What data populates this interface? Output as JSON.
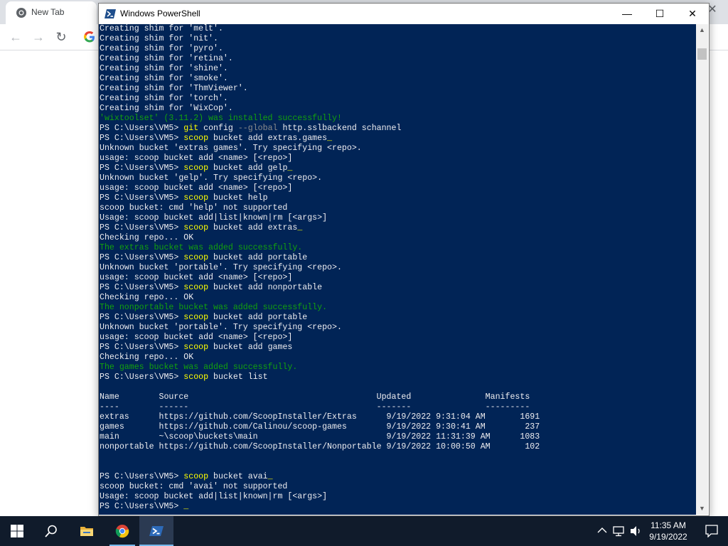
{
  "chrome": {
    "tab_title": "New Tab"
  },
  "powershell": {
    "title": "Windows PowerShell",
    "lines": [
      [
        {
          "t": "Creating shim for 'melt'."
        }
      ],
      [
        {
          "t": "Creating shim for 'nit'."
        }
      ],
      [
        {
          "t": "Creating shim for 'pyro'."
        }
      ],
      [
        {
          "t": "Creating shim for 'retina'."
        }
      ],
      [
        {
          "t": "Creating shim for 'shine'."
        }
      ],
      [
        {
          "t": "Creating shim for 'smoke'."
        }
      ],
      [
        {
          "t": "Creating shim for 'ThmViewer'."
        }
      ],
      [
        {
          "t": "Creating shim for 'torch'."
        }
      ],
      [
        {
          "t": "Creating shim for 'WixCop'."
        }
      ],
      [
        {
          "t": "'wixtoolset' (3.11.2) was installed successfully!",
          "c": "ok"
        }
      ],
      [
        {
          "t": "PS C:\\Users\\VM5> "
        },
        {
          "t": "git",
          "c": "kw"
        },
        {
          "t": " config "
        },
        {
          "t": "--global",
          "c": "arg"
        },
        {
          "t": " http.sslbackend schannel"
        }
      ],
      [
        {
          "t": "PS C:\\Users\\VM5> "
        },
        {
          "t": "scoop",
          "c": "kw"
        },
        {
          "t": " bucket add extras.games"
        },
        {
          "t": "_",
          "c": "cur"
        }
      ],
      [
        {
          "t": "Unknown bucket 'extras games'. Try specifying <repo>."
        }
      ],
      [
        {
          "t": "usage: scoop bucket add <name> [<repo>]"
        }
      ],
      [
        {
          "t": "PS C:\\Users\\VM5> "
        },
        {
          "t": "scoop",
          "c": "kw"
        },
        {
          "t": " bucket add gelp"
        },
        {
          "t": "_",
          "c": "cur"
        }
      ],
      [
        {
          "t": "Unknown bucket 'gelp'. Try specifying <repo>."
        }
      ],
      [
        {
          "t": "usage: scoop bucket add <name> [<repo>]"
        }
      ],
      [
        {
          "t": "PS C:\\Users\\VM5> "
        },
        {
          "t": "scoop",
          "c": "kw"
        },
        {
          "t": " bucket help"
        }
      ],
      [
        {
          "t": "scoop bucket: cmd 'help' not supported"
        }
      ],
      [
        {
          "t": "Usage: scoop bucket add|list|known|rm [<args>]"
        }
      ],
      [
        {
          "t": "PS C:\\Users\\VM5> "
        },
        {
          "t": "scoop",
          "c": "kw"
        },
        {
          "t": " bucket add extras"
        },
        {
          "t": "_",
          "c": "cur"
        }
      ],
      [
        {
          "t": "Checking repo... OK"
        }
      ],
      [
        {
          "t": "The extras bucket was added successfully.",
          "c": "ok"
        }
      ],
      [
        {
          "t": "PS C:\\Users\\VM5> "
        },
        {
          "t": "scoop",
          "c": "kw"
        },
        {
          "t": " bucket add portable"
        }
      ],
      [
        {
          "t": "Unknown bucket 'portable'. Try specifying <repo>."
        }
      ],
      [
        {
          "t": "usage: scoop bucket add <name> [<repo>]"
        }
      ],
      [
        {
          "t": "PS C:\\Users\\VM5> "
        },
        {
          "t": "scoop",
          "c": "kw"
        },
        {
          "t": " bucket add nonportable"
        }
      ],
      [
        {
          "t": "Checking repo... OK"
        }
      ],
      [
        {
          "t": "The nonportable bucket was added successfully.",
          "c": "ok"
        }
      ],
      [
        {
          "t": "PS C:\\Users\\VM5> "
        },
        {
          "t": "scoop",
          "c": "kw"
        },
        {
          "t": " bucket add portable"
        }
      ],
      [
        {
          "t": "Unknown bucket 'portable'. Try specifying <repo>."
        }
      ],
      [
        {
          "t": "usage: scoop bucket add <name> [<repo>]"
        }
      ],
      [
        {
          "t": "PS C:\\Users\\VM5> "
        },
        {
          "t": "scoop",
          "c": "kw"
        },
        {
          "t": " bucket add games"
        }
      ],
      [
        {
          "t": "Checking repo... OK"
        }
      ],
      [
        {
          "t": "The games bucket was added successfully.",
          "c": "ok"
        }
      ],
      [
        {
          "t": "PS C:\\Users\\VM5> "
        },
        {
          "t": "scoop",
          "c": "kw"
        },
        {
          "t": " bucket list"
        }
      ],
      [
        {
          "t": ""
        }
      ],
      [
        {
          "t": "Name        Source                                      Updated               Manifests"
        }
      ],
      [
        {
          "t": "----        ------                                      -------               ---------"
        }
      ],
      [
        {
          "t": "extras      https://github.com/ScoopInstaller/Extras      9/19/2022 9:31:04 AM       1691"
        }
      ],
      [
        {
          "t": "games       https://github.com/Calinou/scoop-games        9/19/2022 9:30:41 AM        237"
        }
      ],
      [
        {
          "t": "main        ~\\scoop\\buckets\\main                          9/19/2022 11:31:39 AM      1083"
        }
      ],
      [
        {
          "t": "nonportable https://github.com/ScoopInstaller/Nonportable 9/19/2022 10:00:50 AM       102"
        }
      ],
      [
        {
          "t": ""
        }
      ],
      [
        {
          "t": ""
        }
      ],
      [
        {
          "t": "PS C:\\Users\\VM5> "
        },
        {
          "t": "scoop",
          "c": "kw"
        },
        {
          "t": " bucket avai"
        },
        {
          "t": "_",
          "c": "cur"
        }
      ],
      [
        {
          "t": "scoop bucket: cmd 'avai' not supported"
        }
      ],
      [
        {
          "t": "Usage: scoop bucket add|list|known|rm [<args>]"
        }
      ],
      [
        {
          "t": "PS C:\\Users\\VM5> "
        },
        {
          "t": "_",
          "c": "cur"
        }
      ]
    ]
  },
  "taskbar": {
    "items": [
      "start-button",
      "search",
      "file-explorer",
      "chrome",
      "powershell"
    ],
    "clock_time": "11:35 AM",
    "clock_date": "9/19/2022"
  },
  "colors": {
    "console_bg": "#012456",
    "console_fg": "#eeedf0",
    "command": "#ffff00",
    "success": "#13a10e",
    "taskbar": "#101b2b"
  }
}
